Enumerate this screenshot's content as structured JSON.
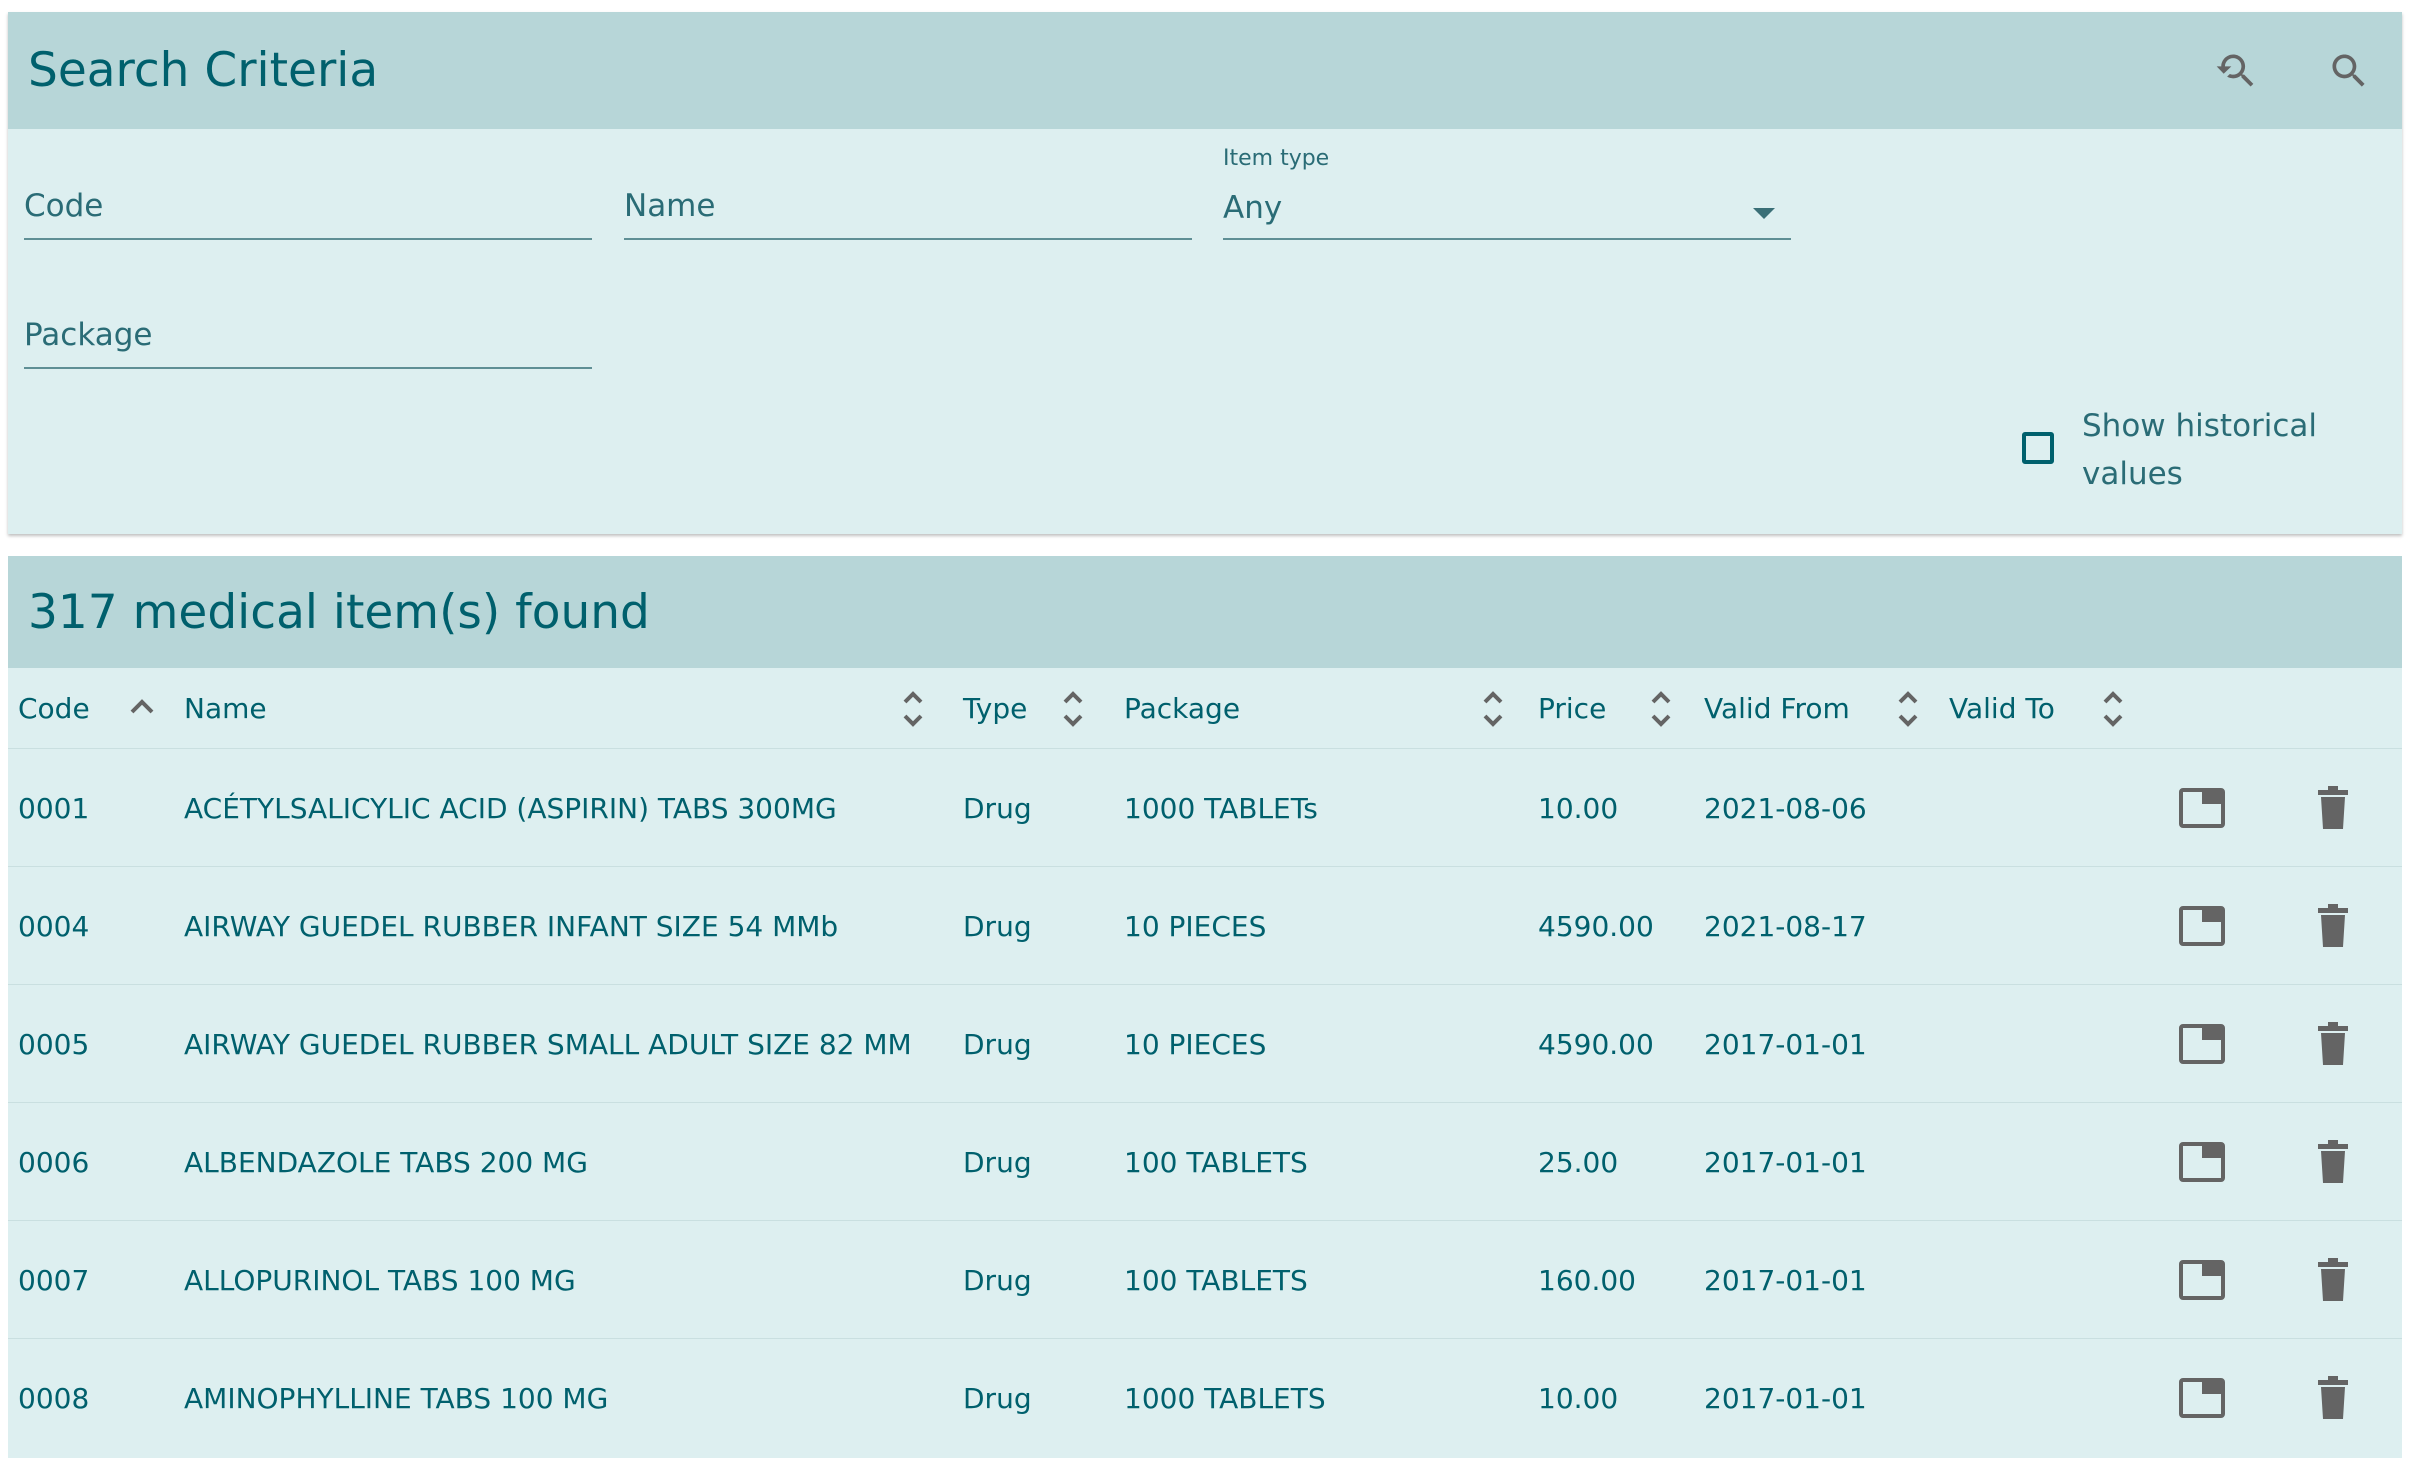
{
  "search_panel": {
    "title": "Search Criteria",
    "reset_icon": "search-reset-icon",
    "search_icon": "search-icon",
    "code_placeholder": "Code",
    "name_placeholder": "Name",
    "item_type_label": "Item type",
    "item_type_value": "Any",
    "package_placeholder": "Package",
    "show_historical_label": "Show historical values",
    "show_historical_checked": false
  },
  "results_panel": {
    "title": "317 medical item(s) found",
    "columns": [
      "Code",
      "Name",
      "Type",
      "Package",
      "Price",
      "Valid From",
      "Valid To"
    ],
    "rows": [
      {
        "code": "0001",
        "name": "ACÉTYLSALICYLIC ACID (ASPIRIN) TABS 300MG",
        "type": "Drug",
        "package": "1000 TABLETs",
        "price": "10.00",
        "valid_from": "2021-08-06",
        "valid_to": ""
      },
      {
        "code": "0004",
        "name": "AIRWAY GUEDEL RUBBER INFANT SIZE 54 MMb",
        "type": "Drug",
        "package": "10 PIECES",
        "price": "4590.00",
        "valid_from": "2021-08-17",
        "valid_to": ""
      },
      {
        "code": "0005",
        "name": "AIRWAY GUEDEL RUBBER SMALL ADULT SIZE 82 MM",
        "type": "Drug",
        "package": "10 PIECES",
        "price": "4590.00",
        "valid_from": "2017-01-01",
        "valid_to": ""
      },
      {
        "code": "0006",
        "name": "ALBENDAZOLE TABS 200 MG",
        "type": "Drug",
        "package": "100 TABLETS",
        "price": "25.00",
        "valid_from": "2017-01-01",
        "valid_to": ""
      },
      {
        "code": "0007",
        "name": "ALLOPURINOL TABS 100 MG",
        "type": "Drug",
        "package": "100 TABLETS",
        "price": "160.00",
        "valid_from": "2017-01-01",
        "valid_to": ""
      },
      {
        "code": "0008",
        "name": "AMINOPHYLLINE TABS 100 MG",
        "type": "Drug",
        "package": "1000 TABLETS",
        "price": "10.00",
        "valid_from": "2017-01-01",
        "valid_to": ""
      }
    ],
    "row_icons": [
      "open-icon",
      "delete-icon"
    ]
  },
  "colors": {
    "header_bg": "#b7d6d8",
    "panel_bg": "#ddeff0",
    "text": "#00606d",
    "icon_gray": "#646464"
  }
}
